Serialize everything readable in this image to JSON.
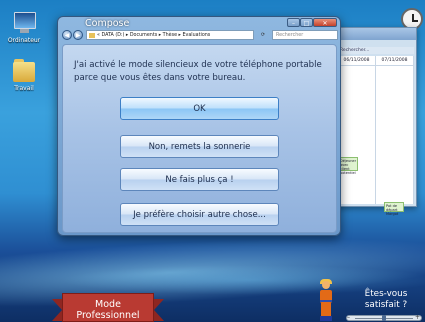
{
  "desktop": {
    "icons": [
      {
        "label": "Ordinateur"
      },
      {
        "label": "Travail"
      }
    ]
  },
  "background_window": {
    "search_placeholder": "Rechercher...",
    "days": [
      "06/11/2008",
      "07/11/2008"
    ],
    "events": [
      {
        "text": "Déjeuner avec client potentiel"
      },
      {
        "text": "Pot de départ Margot"
      }
    ]
  },
  "window": {
    "title": "Compose",
    "controls": {
      "min": "–",
      "max": "□",
      "close": "✕"
    },
    "nav": {
      "back": "◀",
      "forward": "▶"
    },
    "address": "« DATA (D:) ▸ Documents ▸ Thèse ▸ Evaluations",
    "search_placeholder": "Rechercher",
    "refresh": "⟳"
  },
  "dialog": {
    "message": "J'ai activé le mode silencieux de votre téléphone portable parce que vous êtes dans votre bureau.",
    "buttons": [
      {
        "label": "OK",
        "default": true
      },
      {
        "label": "Non, remets la sonnerie"
      },
      {
        "label": "Ne fais plus ça !"
      },
      {
        "label": "Je préfère choisir autre chose..."
      }
    ]
  },
  "footer": {
    "mode_label": "Mode Professionnel",
    "question": "Êtes-vous satisfait ?",
    "slider": {
      "minus": "–",
      "plus": "+",
      "value": 0.5
    }
  }
}
